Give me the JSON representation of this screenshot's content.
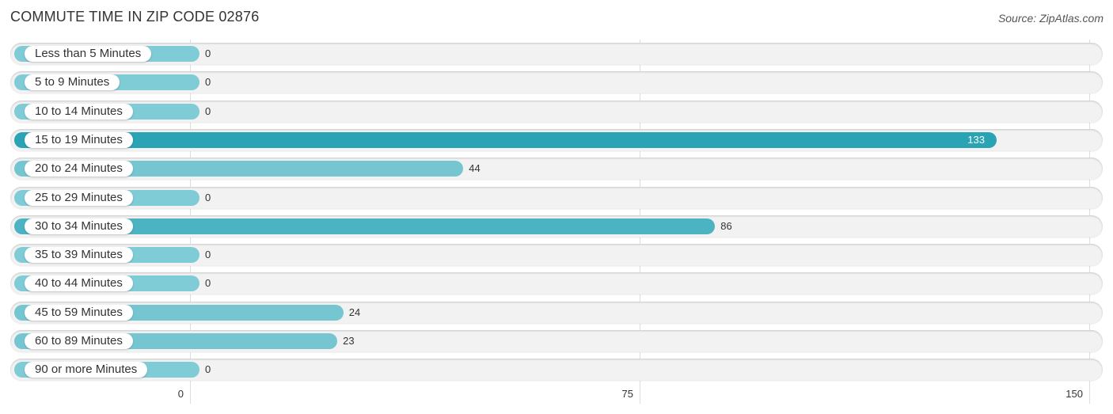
{
  "header": {
    "title": "COMMUTE TIME IN ZIP CODE 02876",
    "source": "Source: ZipAtlas.com"
  },
  "chart_data": {
    "type": "bar",
    "orientation": "horizontal",
    "title": "COMMUTE TIME IN ZIP CODE 02876",
    "source": "Source: ZipAtlas.com",
    "categories": [
      "Less than 5 Minutes",
      "5 to 9 Minutes",
      "10 to 14 Minutes",
      "15 to 19 Minutes",
      "20 to 24 Minutes",
      "25 to 29 Minutes",
      "30 to 34 Minutes",
      "35 to 39 Minutes",
      "40 to 44 Minutes",
      "45 to 59 Minutes",
      "60 to 89 Minutes",
      "90 or more Minutes"
    ],
    "values": [
      0,
      0,
      0,
      133,
      44,
      0,
      86,
      0,
      0,
      24,
      23,
      0
    ],
    "xlabel": "",
    "ylabel": "",
    "xlim": [
      0,
      150
    ],
    "xticks": [
      0,
      75,
      150
    ],
    "grid": true,
    "legend": "none",
    "colors": {
      "max": "#2aa3b5",
      "high": "#4cb3c2",
      "default": "#76c6d1",
      "zero": "#7fcbd6"
    }
  }
}
